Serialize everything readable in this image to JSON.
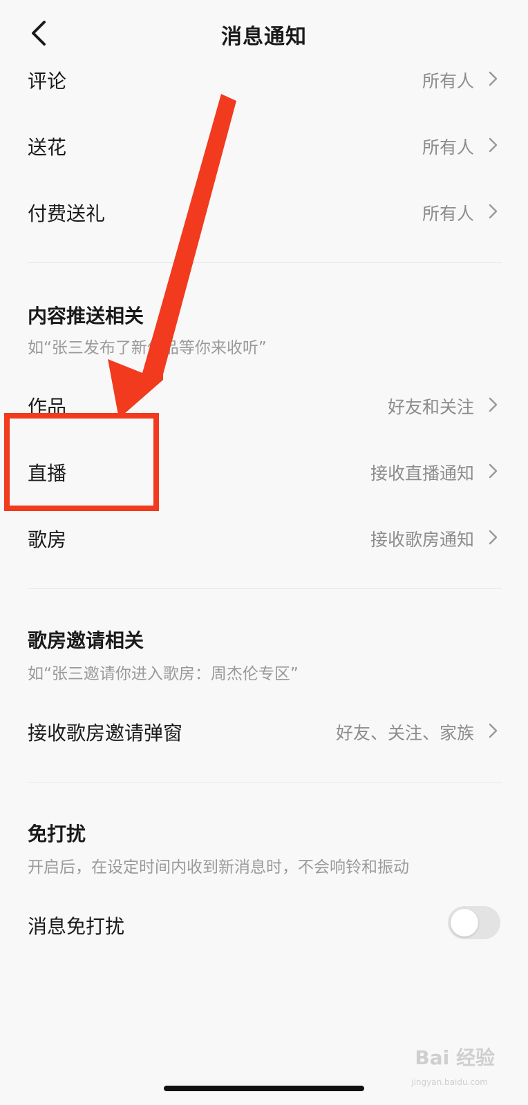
{
  "header": {
    "title": "消息通知",
    "back_icon": "chevron-left-icon"
  },
  "interaction_rows": [
    {
      "label": "评论",
      "value": "所有人"
    },
    {
      "label": "送花",
      "value": "所有人"
    },
    {
      "label": "付费送礼",
      "value": "所有人"
    }
  ],
  "content_section": {
    "title": "内容推送相关",
    "desc": "如“张三发布了新作品等你来收听”",
    "rows": [
      {
        "label": "作品",
        "value": "好友和关注"
      },
      {
        "label": "直播",
        "value": "接收直播通知"
      },
      {
        "label": "歌房",
        "value": "接收歌房通知"
      }
    ]
  },
  "invite_section": {
    "title": "歌房邀请相关",
    "desc": "如“张三邀请你进入歌房：周杰伦专区”",
    "rows": [
      {
        "label": "接收歌房邀请弹窗",
        "value": "好友、关注、家族"
      }
    ]
  },
  "dnd_section": {
    "title": "免打扰",
    "desc": "开启后，在设定时间内收到新消息时，不会响铃和振动",
    "toggle_label": "消息免打扰",
    "toggle_on": false
  },
  "annotation": {
    "highlight_color": "#f23a1e"
  },
  "watermark": {
    "text": "Bai 经验",
    "sub": "jingyan.baidu.com"
  }
}
